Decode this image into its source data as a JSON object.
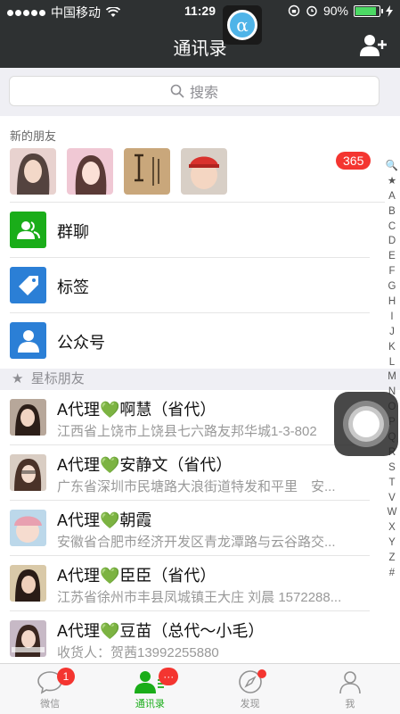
{
  "status": {
    "carrier": "中国移动",
    "time": "11:29",
    "battery": "90%",
    "battery_level": 0.9
  },
  "nav": {
    "title": "通讯录"
  },
  "search": {
    "placeholder": "搜索"
  },
  "new_friends": {
    "label": "新的朋友",
    "count": "365"
  },
  "rows": [
    {
      "label": "群聊",
      "icon": "group-chat-icon",
      "color": "#1aad19"
    },
    {
      "label": "标签",
      "icon": "tag-icon",
      "color": "#2b7fd6"
    },
    {
      "label": "公众号",
      "icon": "official-account-icon",
      "color": "#2b7fd6"
    }
  ],
  "starred": {
    "label": "星标朋友"
  },
  "contacts": [
    {
      "name": "A代理💚啊慧（省代）",
      "sub": "江西省上饶市上饶县七六路友邦华城1-3-802"
    },
    {
      "name": "A代理💚安静文（省代）",
      "sub": "广东省深圳市民塘路大浪街道特发和平里　安..."
    },
    {
      "name": "A代理💚朝霞",
      "sub": "安徽省合肥市经济开发区青龙潭路与云谷路交..."
    },
    {
      "name": "A代理💚臣臣（省代）",
      "sub": "江苏省徐州市丰县凤城镇王大庄 刘晨 1572288..."
    },
    {
      "name": "A代理💚豆苗（总代～小毛）",
      "sub": "收货人：贺茜13992255880"
    }
  ],
  "index": [
    "🔍",
    "★",
    "A",
    "B",
    "C",
    "D",
    "E",
    "F",
    "G",
    "H",
    "I",
    "J",
    "K",
    "L",
    "M",
    "N",
    "O",
    "P",
    "Q",
    "R",
    "S",
    "T",
    "V",
    "W",
    "X",
    "Y",
    "Z",
    "#"
  ],
  "tabs": [
    {
      "label": "微信",
      "badge": "1"
    },
    {
      "label": "通讯录",
      "badge": "···"
    },
    {
      "label": "发现"
    },
    {
      "label": "我"
    }
  ],
  "colors": {
    "accent": "#1aad19",
    "navbar": "#2e3132",
    "badge": "#f43530"
  }
}
